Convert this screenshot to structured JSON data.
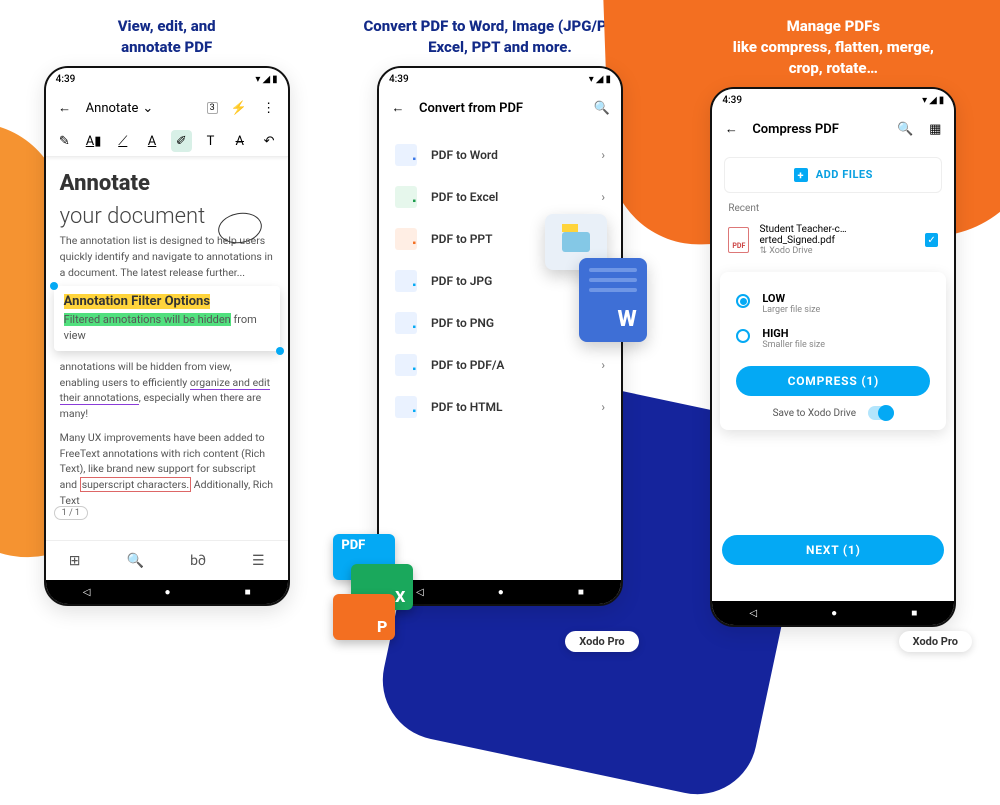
{
  "panels": {
    "p1": {
      "headline": "View, edit, and\nannotate PDF",
      "statusbar": {
        "time": "4:39",
        "icons": "▾▮◢"
      },
      "appbar": {
        "mode": "Annotate",
        "tab_count": "3"
      },
      "doc": {
        "title_bold": "Annotate",
        "title_light": "your document",
        "para1": "The annotation list is designed to help users quickly identify and navigate to annotations in a document. The latest release further...",
        "filter_title": "Annotation Filter Options",
        "filter_hl": "Filtered annotations will be hidden",
        "filter_tail": " from view",
        "para2a": "annotations will be hidden from view, enabling users to efficiently ",
        "para2b": "organize and edit their annotations",
        "para2c": ", especially when there are many!",
        "para3a": "Many UX improvements have been added to FreeText annotations with rich content (Rich Text), like brand new support for subscript and ",
        "para3b": "superscript characters.",
        "para3c": " Additionally, Rich Text",
        "page": "1 / 1"
      }
    },
    "p2": {
      "headline": "Convert PDF to Word, Image (JPG/PNG), Excel, PPT and more.",
      "statusbar": {
        "time": "4:39"
      },
      "appbar": {
        "title": "Convert from PDF"
      },
      "list": [
        {
          "label": "PDF to Word",
          "cls": "fi-w"
        },
        {
          "label": "PDF to Excel",
          "cls": "fi-x"
        },
        {
          "label": "PDF to PPT",
          "cls": "fi-p"
        },
        {
          "label": "PDF to JPG",
          "cls": "fi-j"
        },
        {
          "label": "PDF to PNG",
          "cls": "fi-j"
        },
        {
          "label": "PDF to PDF/A",
          "cls": "fi-j"
        },
        {
          "label": "PDF to HTML",
          "cls": "fi-j"
        }
      ],
      "badges": {
        "pdf": "PDF",
        "xls": "X",
        "ppt": "P",
        "word": "W"
      },
      "pill": "Xodo Pro"
    },
    "p3": {
      "headline": "Manage PDFs\nlike compress, flatten, merge,\ncrop, rotate…",
      "statusbar": {
        "time": "4:39"
      },
      "appbar": {
        "title": "Compress PDF"
      },
      "addfiles": "ADD FILES",
      "recent_label": "Recent",
      "file": {
        "name": "Student Teacher-c…erted_Signed.pdf",
        "drive": "⇅ Xodo Drive"
      },
      "quality": {
        "low": {
          "title": "LOW",
          "sub": "Larger file size"
        },
        "high": {
          "title": "HIGH",
          "sub": "Smaller file size"
        }
      },
      "compress_btn": "COMPRESS (1)",
      "save_label": "Save to Xodo Drive",
      "next_btn": "NEXT (1)",
      "pill": "Xodo Pro"
    }
  }
}
